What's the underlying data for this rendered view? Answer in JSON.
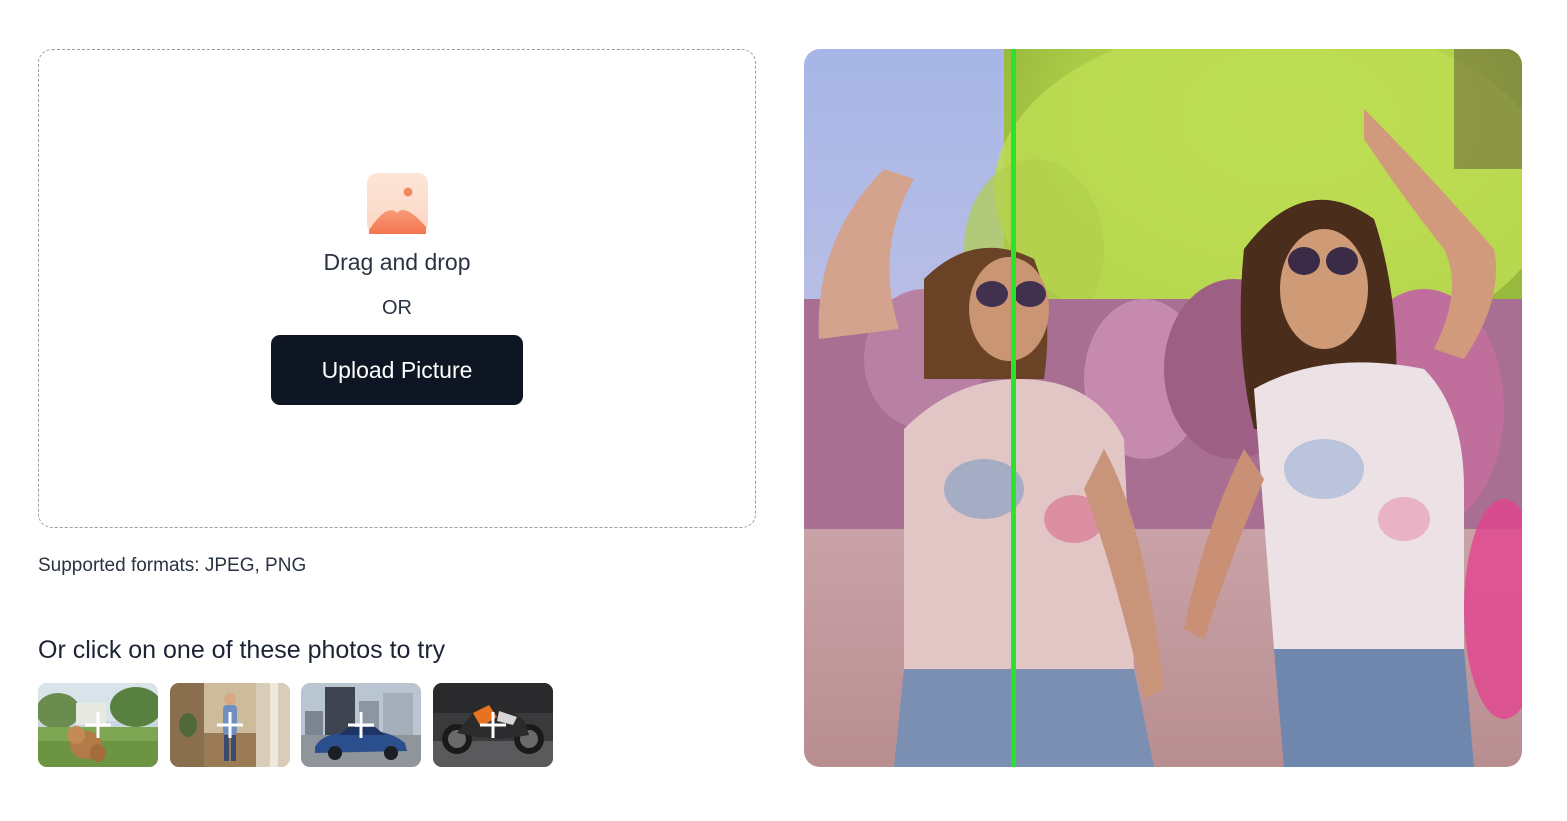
{
  "upload": {
    "drag_text": "Drag and drop",
    "or_text": "OR",
    "button_label": "Upload Picture",
    "icon": "image-placeholder-icon"
  },
  "formats_text": "Supported formats: JPEG, PNG",
  "samples": {
    "heading": "Or click on one of these photos to try",
    "items": [
      {
        "subject": "dog"
      },
      {
        "subject": "person"
      },
      {
        "subject": "car"
      },
      {
        "subject": "motorcycle"
      }
    ],
    "add_icon": "plus-icon"
  },
  "preview": {
    "divider_color": "#29e32d"
  },
  "colors": {
    "button_bg": "#0f1623",
    "button_text": "#ffffff",
    "dropzone_border": "#9a9ea6"
  }
}
